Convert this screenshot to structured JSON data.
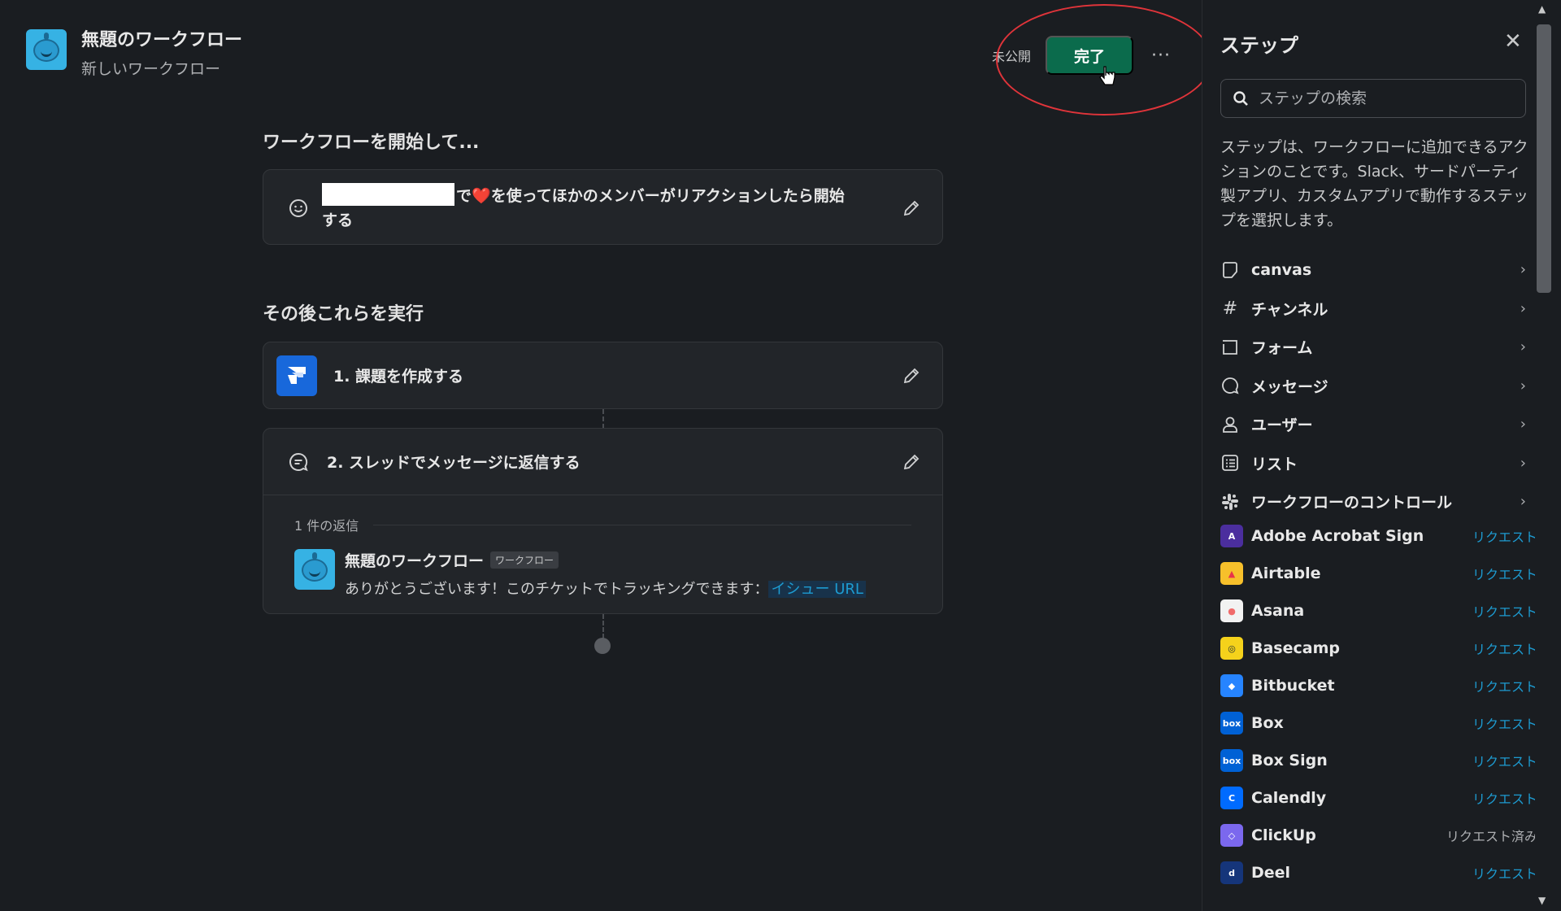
{
  "header": {
    "title": "無題のワークフロー",
    "subtitle": "新しいワークフロー"
  },
  "actions": {
    "status": "未公開",
    "done_label": "完了",
    "more_label": "···"
  },
  "trigger": {
    "heading": "ワークフローを開始して...",
    "text_suffix": "で",
    "emoji": "❤️",
    "text_rest": "を使ってほかのメンバーがリアクションしたら開始する"
  },
  "steps_heading": "その後これらを実行",
  "steps": [
    {
      "label": "1. 課題を作成する"
    },
    {
      "label": "2. スレッドでメッセージに返信する"
    }
  ],
  "reply": {
    "count": "1 件の返信",
    "name": "無題のワークフロー",
    "tag": "ワークフロー",
    "text": "ありがとうございます！このチケットでトラッキングできます：",
    "link": "イシュー URL"
  },
  "panel": {
    "title": "ステップ",
    "search_placeholder": "ステップの検索",
    "description": "ステップは、ワークフローに追加できるアクションのことです。Slack、サードパーティ製アプリ、カスタムアプリで動作するステップを選択します。",
    "categories": [
      {
        "label": "canvas",
        "icon": "canvas-icon"
      },
      {
        "label": "チャンネル",
        "icon": "hash-icon"
      },
      {
        "label": "フォーム",
        "icon": "form-icon"
      },
      {
        "label": "メッセージ",
        "icon": "message-icon"
      },
      {
        "label": "ユーザー",
        "icon": "user-icon"
      },
      {
        "label": "リスト",
        "icon": "list-icon"
      },
      {
        "label": "ワークフローのコントロール",
        "icon": "slack-icon"
      }
    ],
    "apps": [
      {
        "name": "Adobe Acrobat Sign",
        "action": "リクエスト",
        "color": "#4b2e9e",
        "mark": "A"
      },
      {
        "name": "Airtable",
        "action": "リクエスト",
        "color": "#f7c02b",
        "mark": "▲"
      },
      {
        "name": "Asana",
        "action": "リクエスト",
        "color": "#f2f2f2",
        "mark": "●"
      },
      {
        "name": "Basecamp",
        "action": "リクエスト",
        "color": "#f5d21b",
        "mark": "◎"
      },
      {
        "name": "Bitbucket",
        "action": "リクエスト",
        "color": "#2684ff",
        "mark": "◆"
      },
      {
        "name": "Box",
        "action": "リクエスト",
        "color": "#0061d5",
        "mark": "box"
      },
      {
        "name": "Box Sign",
        "action": "リクエスト",
        "color": "#0061d5",
        "mark": "box"
      },
      {
        "name": "Calendly",
        "action": "リクエスト",
        "color": "#006bff",
        "mark": "C"
      },
      {
        "name": "ClickUp",
        "action": "リクエスト済み",
        "color": "#7b68ee",
        "mark": "◇"
      },
      {
        "name": "Deel",
        "action": "リクエスト",
        "color": "#15357a",
        "mark": "d"
      }
    ]
  }
}
